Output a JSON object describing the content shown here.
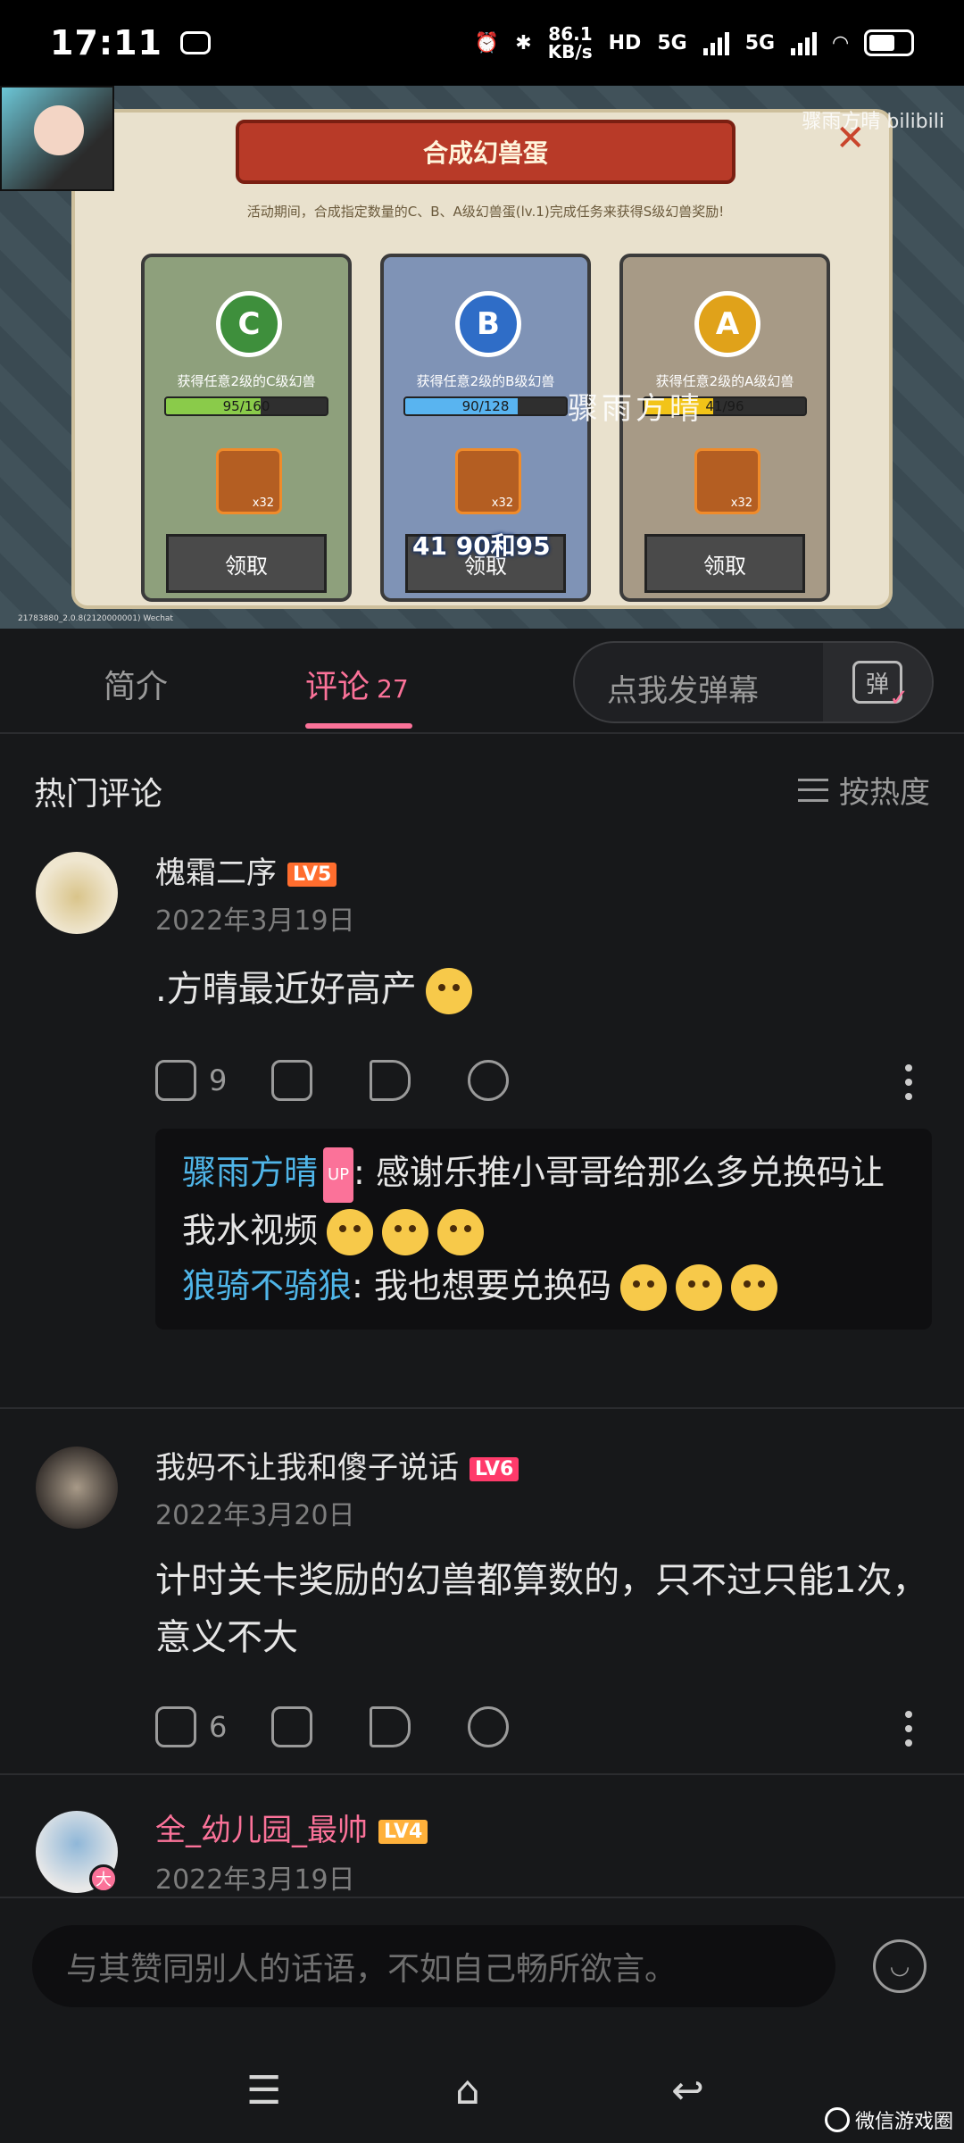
{
  "status_bar": {
    "time": "17:11",
    "net_speed": "86.1",
    "net_unit": "KB/s",
    "hd_label": "HD",
    "signal1": "5G",
    "signal2": "5G"
  },
  "video": {
    "watermark": "骤雨方晴 bilibili",
    "panel_title": "合成幻兽蛋",
    "panel_desc": "活动期间，合成指定数量的C、B、A级幻兽蛋(lv.1)完成任务来获得S级幻兽奖励!",
    "cards": [
      {
        "grade": "C",
        "task": "获得任意2级的C级幻兽",
        "progress_text": "95/160",
        "progress": 0.59,
        "qty": "x32",
        "claim": "领取"
      },
      {
        "grade": "B",
        "task": "获得任意2级的B级幻兽",
        "progress_text": "90/128",
        "progress": 0.7,
        "qty": "x32",
        "claim": "领取"
      },
      {
        "grade": "A",
        "task": "获得任意2级的A级幻兽",
        "progress_text": "41/96",
        "progress": 0.43,
        "qty": "x32",
        "claim": "领取"
      }
    ],
    "overlay_text": "骤雨方晴",
    "subtitle": "41 90和95",
    "tiny_info": "21783880_2.0.8(2120000001) Wechat",
    "played_fraction": 0.42
  },
  "tabs": {
    "intro": "简介",
    "comments": "评论",
    "comment_count": "27",
    "danmaku_placeholder": "点我发弹幕",
    "danmaku_icon": "弹"
  },
  "hot": {
    "title": "热门评论",
    "sort_label": "按热度"
  },
  "comments": [
    {
      "user": "槐霜二序",
      "level": "LV5",
      "date": "2022年3月19日",
      "text": ".方晴最近好高产",
      "likes": "9",
      "replies": [
        {
          "user": "骤雨方晴",
          "up_tag": "UP",
          "text": ": 感谢乐推小哥哥给那么多兑换码让我水视频"
        },
        {
          "user": "狼骑不骑狼",
          "text": ": 我也想要兑换码"
        }
      ]
    },
    {
      "user": "我妈不让我和傻子说话",
      "level": "LV6",
      "date": "2022年3月20日",
      "text": "计时关卡奖励的幻兽都算数的，只不过只能1次，意义不大",
      "likes": "6"
    },
    {
      "user": "全_幼儿园_最帅",
      "level": "LV4",
      "date": "2022年3月19日",
      "badge": "大"
    }
  ],
  "input": {
    "placeholder": "与其赞同别人的话语，不如自己畅所欲言。"
  },
  "corner_mark": "微信游戏圈",
  "colors": {
    "accent": "#fb7299",
    "reply_user": "#4fb5e8",
    "background": "#17181a"
  }
}
